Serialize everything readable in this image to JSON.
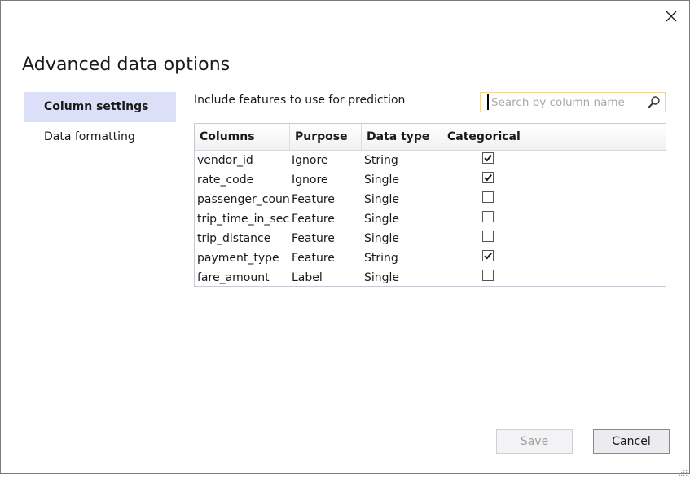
{
  "dialog": {
    "title": "Advanced data options",
    "close_icon": "close-icon"
  },
  "nav": {
    "items": [
      {
        "label": "Column settings",
        "active": true
      },
      {
        "label": "Data formatting",
        "active": false
      }
    ]
  },
  "main": {
    "instructions": "Include features to use for prediction",
    "search": {
      "value": "",
      "placeholder": "Search by column name",
      "icon": "search-icon"
    },
    "grid": {
      "headers": [
        "Columns",
        "Purpose",
        "Data type",
        "Categorical"
      ],
      "rows": [
        {
          "column": "vendor_id",
          "purpose": "Ignore",
          "data_type": "String",
          "categorical": true
        },
        {
          "column": "rate_code",
          "purpose": "Ignore",
          "data_type": "Single",
          "categorical": true
        },
        {
          "column": "passenger_count",
          "purpose": "Feature",
          "data_type": "Single",
          "categorical": false
        },
        {
          "column": "trip_time_in_secs",
          "purpose": "Feature",
          "data_type": "Single",
          "categorical": false
        },
        {
          "column": "trip_distance",
          "purpose": "Feature",
          "data_type": "Single",
          "categorical": false
        },
        {
          "column": "payment_type",
          "purpose": "Feature",
          "data_type": "String",
          "categorical": true
        },
        {
          "column": "fare_amount",
          "purpose": "Label",
          "data_type": "Single",
          "categorical": false
        }
      ]
    }
  },
  "footer": {
    "save_label": "Save",
    "save_enabled": false,
    "cancel_label": "Cancel"
  },
  "colors": {
    "nav_active_bg": "#dbdff7",
    "search_border": "#f5d48f"
  }
}
